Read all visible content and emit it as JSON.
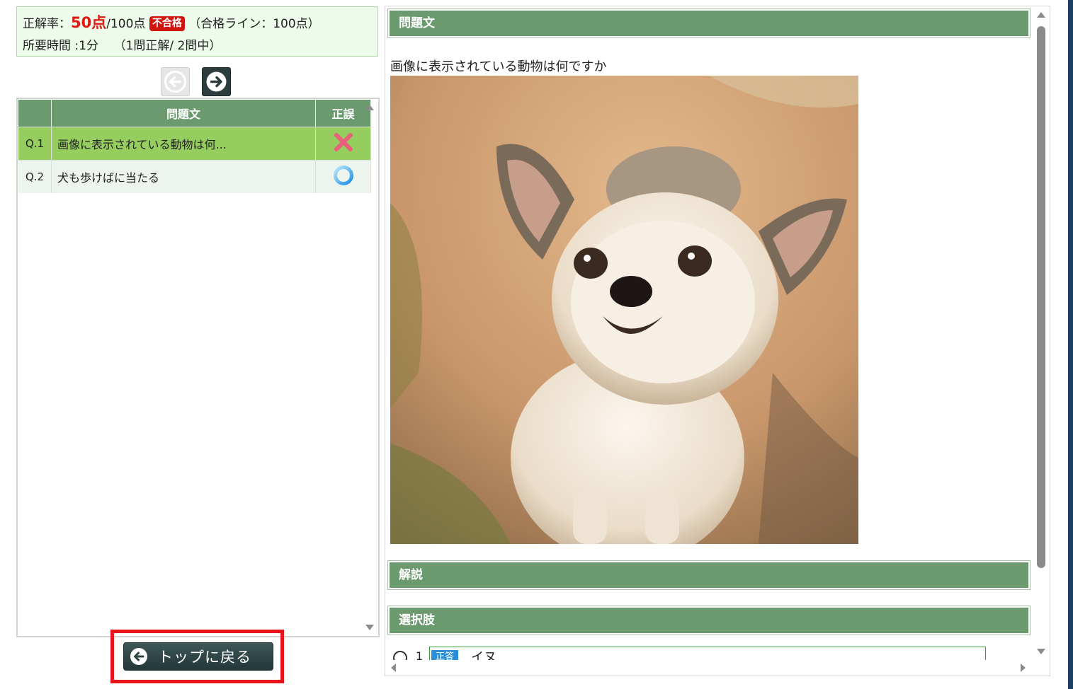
{
  "score": {
    "label": "正解率：",
    "value": "50点",
    "total": "/100点",
    "badge": "不合格",
    "pass_line": "（合格ライン：100点）",
    "time": "所要時間 :1分",
    "summary": "（1問正解/ 2問中）"
  },
  "table": {
    "col_question": "問題文",
    "col_result": "正誤",
    "rows": [
      {
        "num": "Q.1",
        "text": "画像に表示されている動物は何...",
        "result": "incorrect"
      },
      {
        "num": "Q.2",
        "text": "犬も歩けばに当たる",
        "result": "correct"
      }
    ]
  },
  "back_button": "トップに戻る",
  "detail": {
    "question_header": "問題文",
    "question_text": "画像に表示されている動物は何ですか",
    "explanation_header": "解説",
    "choices_header": "選択肢",
    "choices": [
      {
        "num": "1",
        "tag": "正答",
        "text": "イヌ"
      }
    ]
  },
  "colors": {
    "header_green": "#6b9a6e",
    "row_selected": "#95cd5f",
    "fail_red": "#d0150f",
    "highlight_red": "#e8141c"
  }
}
